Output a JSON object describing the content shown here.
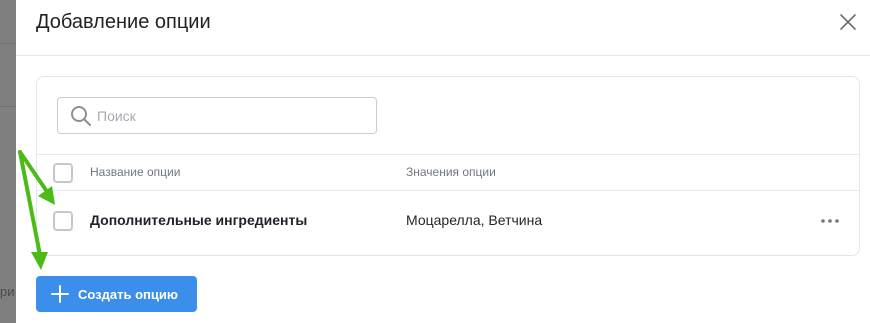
{
  "backdrop": {
    "partial_text": "ри"
  },
  "modal": {
    "title": "Добавление опции",
    "close_icon": "close-icon"
  },
  "search": {
    "placeholder": "Поиск",
    "value": "",
    "icon": "search-icon"
  },
  "table": {
    "columns": [
      "Название опции",
      "Значения опции"
    ],
    "rows": [
      {
        "name": "Дополнительные ингредиенты",
        "values": "Моцарелла, Ветчина",
        "checked": false
      }
    ],
    "select_all_checked": false
  },
  "footer": {
    "create_button_label": "Создать опцию"
  },
  "colors": {
    "primary": "#3b8eea",
    "annotation_arrow": "#4cbb17"
  }
}
